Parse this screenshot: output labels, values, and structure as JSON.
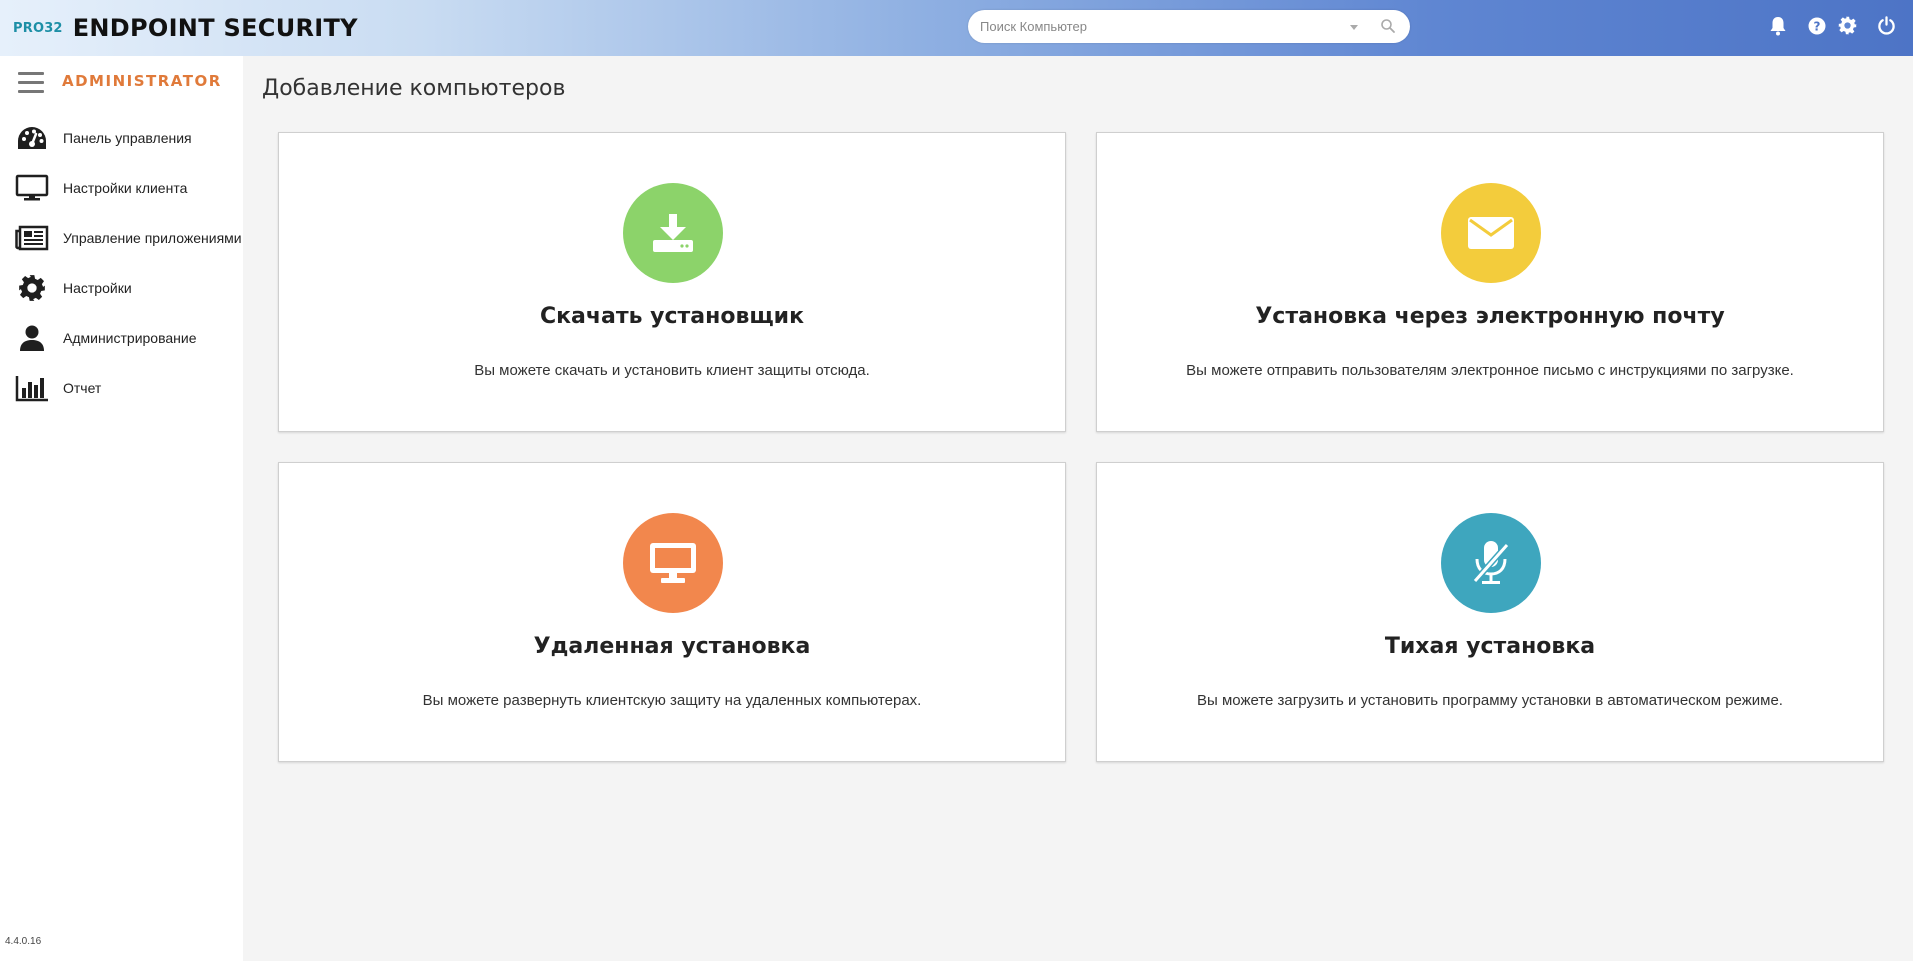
{
  "header": {
    "brand_prefix": "PRO32",
    "brand_title": "ENDPOINT SECURITY",
    "search_placeholder": "Поиск Компьютер",
    "icons": [
      "bell-icon",
      "help-icon",
      "gear-icon",
      "power-icon"
    ]
  },
  "sidebar": {
    "role": "ADMINISTRATOR",
    "items": [
      {
        "label": "Панель управления",
        "icon": "dashboard-icon"
      },
      {
        "label": "Настройки клиента",
        "icon": "monitor-icon"
      },
      {
        "label": "Управление приложениями",
        "icon": "apps-icon"
      },
      {
        "label": "Настройки",
        "icon": "gear-icon"
      },
      {
        "label": "Администрирование",
        "icon": "user-icon"
      },
      {
        "label": "Отчет",
        "icon": "chart-icon"
      }
    ],
    "version": "4.4.0.16"
  },
  "main": {
    "title": "Добавление компьютеров",
    "cards": [
      {
        "title": "Скачать установщик",
        "desc": "Вы можете скачать и установить клиент защиты отсюда.",
        "icon": "download-icon",
        "color": "#8cd36a"
      },
      {
        "title": "Установка через электронную почту",
        "desc": "Вы можете отправить пользователям электронное письмо с инструкциями по загрузке.",
        "icon": "envelope-icon",
        "color": "#f3cc3c"
      },
      {
        "title": "Удаленная установка",
        "desc": "Вы можете развернуть клиентскую защиту на удаленных компьютерах.",
        "icon": "monitor-icon",
        "color": "#f2874d"
      },
      {
        "title": "Тихая установка",
        "desc": "Вы можете загрузить и установить программу установки в автоматическом режиме.",
        "icon": "mute-icon",
        "color": "#3ea6be"
      }
    ]
  },
  "colors": {
    "accent": "#e07a3a",
    "brand": "#1d8fa6"
  }
}
